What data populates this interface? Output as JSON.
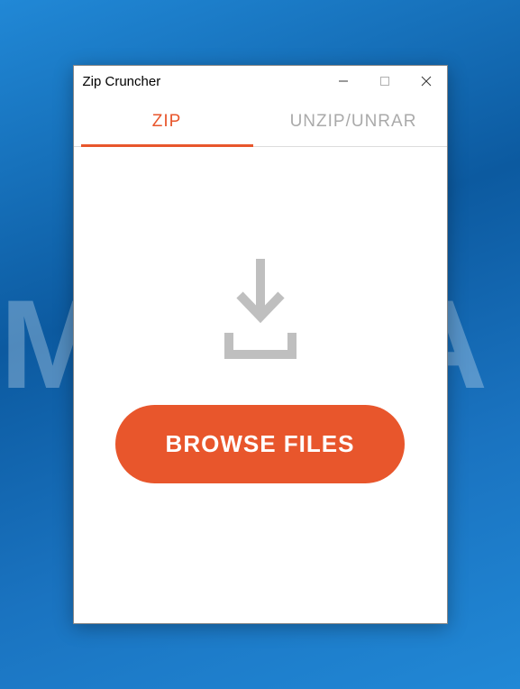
{
  "window": {
    "title": "Zip Cruncher"
  },
  "tabs": {
    "zip": "ZIP",
    "unzip": "UNZIP/UNRAR"
  },
  "content": {
    "browse_button": "BROWSE FILES"
  },
  "watermark": "MALWA"
}
